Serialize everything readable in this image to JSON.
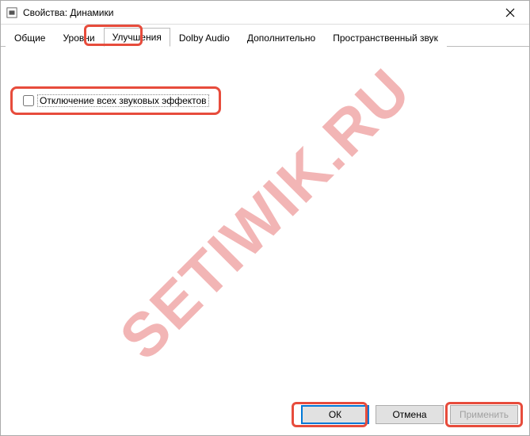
{
  "window": {
    "title": "Свойства: Динамики"
  },
  "tabs": {
    "items": [
      {
        "label": "Общие"
      },
      {
        "label": "Уровни"
      },
      {
        "label": "Улучшения"
      },
      {
        "label": "Dolby Audio"
      },
      {
        "label": "Дополнительно"
      },
      {
        "label": "Пространственный звук"
      }
    ],
    "active_index": 2
  },
  "content": {
    "disable_effects_label": "Отключение всех звуковых эффектов"
  },
  "buttons": {
    "ok": "ОК",
    "cancel": "Отмена",
    "apply": "Применить"
  },
  "watermark": "SETIWIK.RU"
}
